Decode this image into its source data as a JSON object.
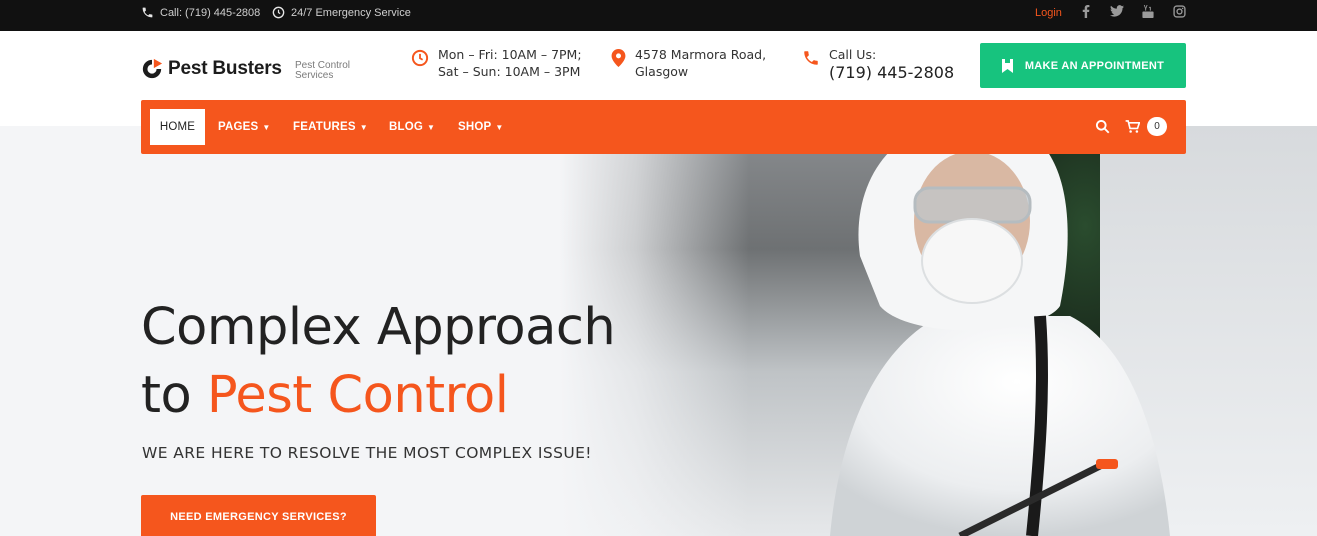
{
  "topbar": {
    "call_text": "Call: (719) 445-2808",
    "emergency_text": "24/7 Emergency Service",
    "login_label": "Login",
    "social_icons": [
      "facebook-icon",
      "twitter-icon",
      "youtube-icon",
      "instagram-icon"
    ]
  },
  "header": {
    "logo_text": "Pest Busters",
    "logo_tagline": "Pest Control Services",
    "hours_line1": "Mon – Fri: 10AM – 7PM;",
    "hours_line2": "Sat – Sun: 10AM – 3PM",
    "address_line1": "4578 Marmora Road,",
    "address_line2": "Glasgow",
    "call_label": "Call Us:",
    "call_number": "(719) 445-2808",
    "appointment_button": "MAKE AN APPOINTMENT"
  },
  "nav": {
    "items": [
      {
        "label": "HOME",
        "active": true
      },
      {
        "label": "PAGES"
      },
      {
        "label": "FEATURES"
      },
      {
        "label": "BLOG"
      },
      {
        "label": "SHOP"
      }
    ],
    "cart_count": "0"
  },
  "hero": {
    "title_line1": "Complex Approach",
    "title_line2_prefix": "to ",
    "title_line2_accent": "Pest Control",
    "subtitle": "WE ARE HERE TO RESOLVE THE MOST COMPLEX ISSUE!",
    "button_label": "NEED EMERGENCY SERVICES?"
  },
  "colors": {
    "accent": "#f5561d",
    "green": "#17c37e",
    "topbar_bg": "#111111"
  }
}
